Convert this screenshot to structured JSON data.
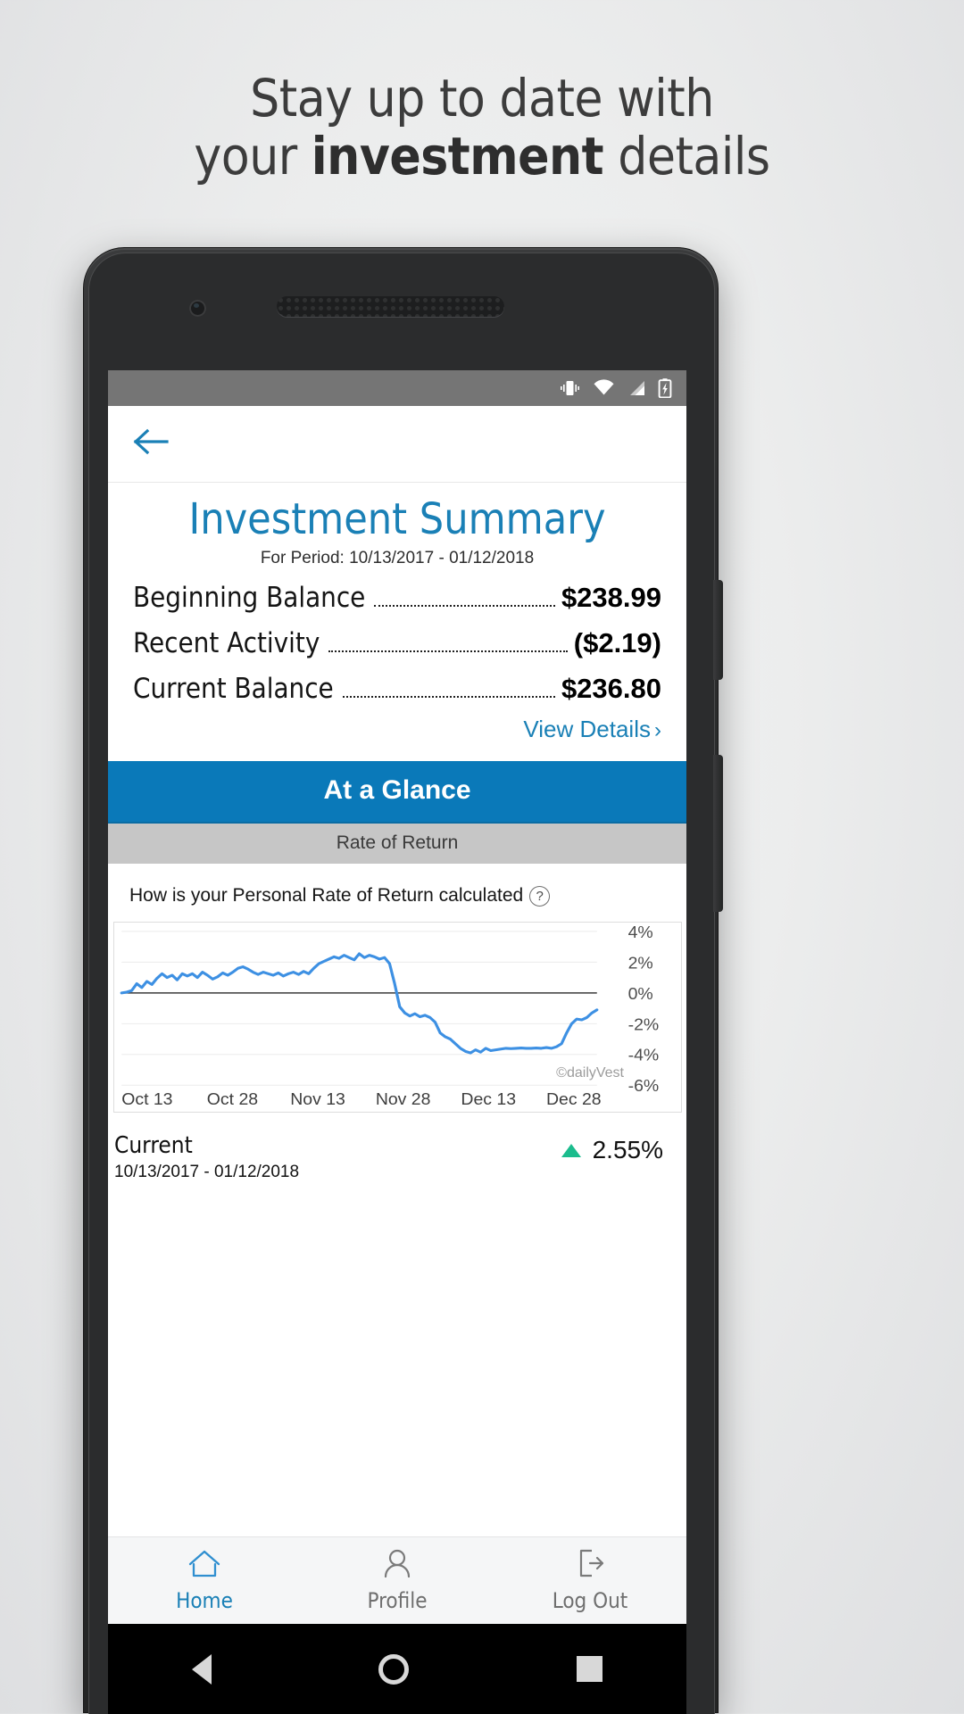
{
  "promo": {
    "line1": "Stay up to date with",
    "line2_pre": "your ",
    "line2_bold": "investment",
    "line2_post": " details"
  },
  "statusbar": {
    "icons": [
      "vibrate-icon",
      "wifi-icon",
      "signal-icon",
      "battery-charging-icon"
    ]
  },
  "appbar": {
    "back_label": "back-arrow"
  },
  "summary": {
    "title": "Investment Summary",
    "period": "For Period: 10/13/2017 - 01/12/2018",
    "rows": [
      {
        "label": "Beginning Balance",
        "value": "$238.99"
      },
      {
        "label": "Recent Activity",
        "value": "($2.19)"
      },
      {
        "label": "Current Balance",
        "value": "$236.80"
      }
    ],
    "view_details": "View Details",
    "chevron": "›"
  },
  "glance": {
    "title": "At a Glance",
    "subtitle": "Rate of Return"
  },
  "question": {
    "text": "How is your Personal Rate of Return calculated",
    "help": "?"
  },
  "chart_data": {
    "type": "line",
    "title": "Personal Rate of Return",
    "xlabel": "",
    "ylabel": "",
    "ylim": [
      -6,
      4
    ],
    "yticks": [
      4,
      2,
      0,
      -2,
      -4,
      -6
    ],
    "ytick_labels": [
      "4%",
      "2%",
      "0%",
      "-2%",
      "-4%",
      "-6%"
    ],
    "xtick_labels": [
      "Oct 13",
      "Oct 28",
      "Nov 13",
      "Nov 28",
      "Dec 13",
      "Dec 28"
    ],
    "grid": true,
    "legend": "none",
    "line_color": "#3d90e3",
    "zero_line_color": "#3a3a3a",
    "watermark": "©dailyVest",
    "series": [
      {
        "name": "Personal Rate of Return",
        "values": [
          0.0,
          0.05,
          0.15,
          0.6,
          0.35,
          0.75,
          0.55,
          0.95,
          1.25,
          1.0,
          1.15,
          0.85,
          1.25,
          1.1,
          1.25,
          1.0,
          1.35,
          1.15,
          0.9,
          1.05,
          1.3,
          1.15,
          1.35,
          1.6,
          1.7,
          1.55,
          1.35,
          1.2,
          1.35,
          1.25,
          1.15,
          1.3,
          1.1,
          1.25,
          1.35,
          1.2,
          1.4,
          1.25,
          1.6,
          1.9,
          2.05,
          2.2,
          2.35,
          2.25,
          2.45,
          2.3,
          2.15,
          2.55,
          2.3,
          2.45,
          2.35,
          2.2,
          2.3,
          1.9,
          0.6,
          -0.9,
          -1.3,
          -1.5,
          -1.35,
          -1.55,
          -1.45,
          -1.6,
          -1.9,
          -2.6,
          -2.85,
          -3.0,
          -3.3,
          -3.6,
          -3.8,
          -3.9,
          -3.7,
          -3.85,
          -3.6,
          -3.75,
          -3.7,
          -3.65,
          -3.6,
          -3.62,
          -3.6,
          -3.58,
          -3.6,
          -3.6,
          -3.58,
          -3.6,
          -3.55,
          -3.6,
          -3.5,
          -3.3,
          -2.6,
          -2.0,
          -1.7,
          -1.75,
          -1.6,
          -1.3,
          -1.1
        ]
      }
    ]
  },
  "current": {
    "label": "Current",
    "date_range": "10/13/2017 - 01/12/2018",
    "direction": "up",
    "percent": "2.55%",
    "accent_green": "#1bbc8d"
  },
  "bottomnav": {
    "items": [
      {
        "label": "Home",
        "icon": "home-icon",
        "active": true
      },
      {
        "label": "Profile",
        "icon": "person-icon",
        "active": false
      },
      {
        "label": "Log Out",
        "icon": "logout-icon",
        "active": false
      }
    ]
  },
  "androidnav": {
    "items": [
      "back-triangle-icon",
      "home-circle-icon",
      "recents-square-icon"
    ]
  },
  "colors": {
    "brand_blue": "#0a79b9",
    "link_blue": "#1a80b6",
    "bar_gray": "#c6c6c6"
  }
}
